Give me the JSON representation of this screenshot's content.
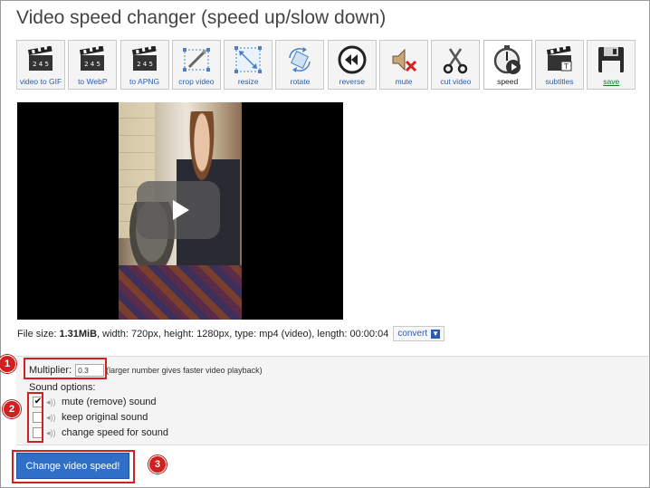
{
  "page": {
    "title": "Video speed changer (speed up/slow down)"
  },
  "toolbar": {
    "items": [
      {
        "label": "video to GIF",
        "icon": "clapperboard-gif-icon"
      },
      {
        "label": "to WebP",
        "icon": "clapperboard-webp-icon"
      },
      {
        "label": "to APNG",
        "icon": "clapperboard-apng-icon"
      },
      {
        "label": "crop video",
        "icon": "crop-icon"
      },
      {
        "label": "resize",
        "icon": "resize-icon"
      },
      {
        "label": "rotate",
        "icon": "rotate-icon"
      },
      {
        "label": "reverse",
        "icon": "rewind-icon"
      },
      {
        "label": "mute",
        "icon": "speaker-mute-icon"
      },
      {
        "label": "cut video",
        "icon": "scissors-icon"
      },
      {
        "label": "speed",
        "icon": "stopwatch-play-icon"
      },
      {
        "label": "subtitles",
        "icon": "clapperboard-subtitles-icon"
      },
      {
        "label": "save",
        "icon": "floppy-disk-icon"
      }
    ],
    "active_label": "speed"
  },
  "video": {
    "play_icon": "play-icon"
  },
  "fileinfo": {
    "prefix": "File size: ",
    "size": "1.31MiB",
    "rest": ", width: 720px, height: 1280px, type: mp4 (video), length: 00:00:04",
    "convert_label": "convert"
  },
  "options": {
    "multiplier_label": "Multiplier:",
    "multiplier_value": "0.3",
    "multiplier_hint": "(larger number gives faster video playback)",
    "sound_label": "Sound options:",
    "sound": [
      {
        "label": "mute (remove) sound",
        "checked": true
      },
      {
        "label": "keep original sound",
        "checked": false
      },
      {
        "label": "change speed for sound",
        "checked": false
      }
    ]
  },
  "submit": {
    "label": "Change video speed!"
  },
  "annotations": {
    "badges": [
      "1",
      "2",
      "3"
    ],
    "color": "#d21f1f"
  },
  "colors": {
    "button_blue": "#2f6fc8",
    "link_blue": "#2a5db0",
    "highlight_red": "#d21f1f"
  }
}
